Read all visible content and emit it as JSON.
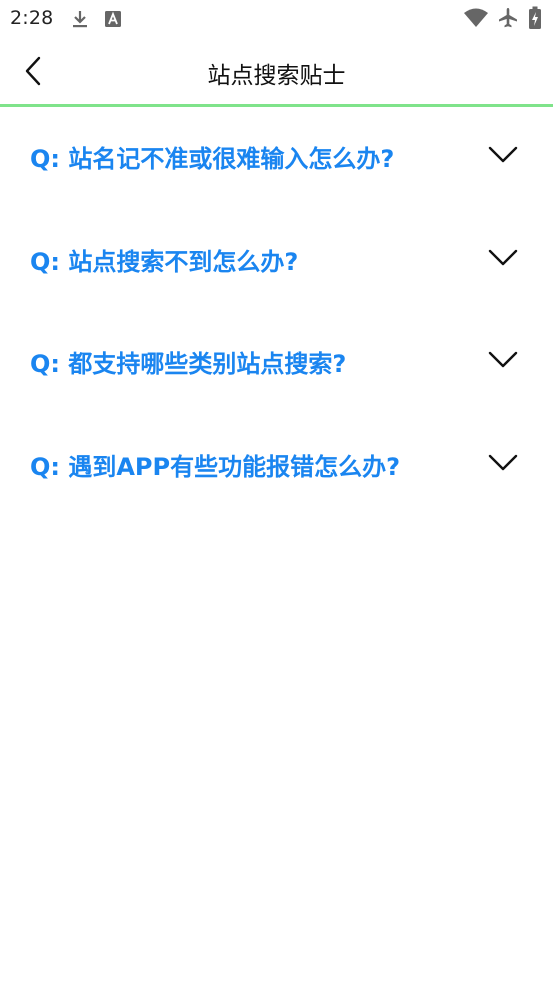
{
  "status_bar": {
    "time": "2:28",
    "icons": [
      "download-icon",
      "keyboard-a-icon",
      "wifi-icon",
      "airplane-mode-icon",
      "battery-charging-icon"
    ]
  },
  "header": {
    "back_icon": "chevron-left-icon",
    "title": "站点搜索贴士"
  },
  "colors": {
    "question_text": "#1a85f0",
    "divider": "#7fe38a",
    "title_text": "#111111"
  },
  "faq": {
    "items": [
      {
        "question": "Q: 站名记不准或很难输入怎么办?",
        "expanded": false
      },
      {
        "question": "Q: 站点搜索不到怎么办?",
        "expanded": false
      },
      {
        "question": "Q: 都支持哪些类别站点搜索?",
        "expanded": false
      },
      {
        "question": "Q: 遇到APP有些功能报错怎么办?",
        "expanded": false
      }
    ]
  }
}
